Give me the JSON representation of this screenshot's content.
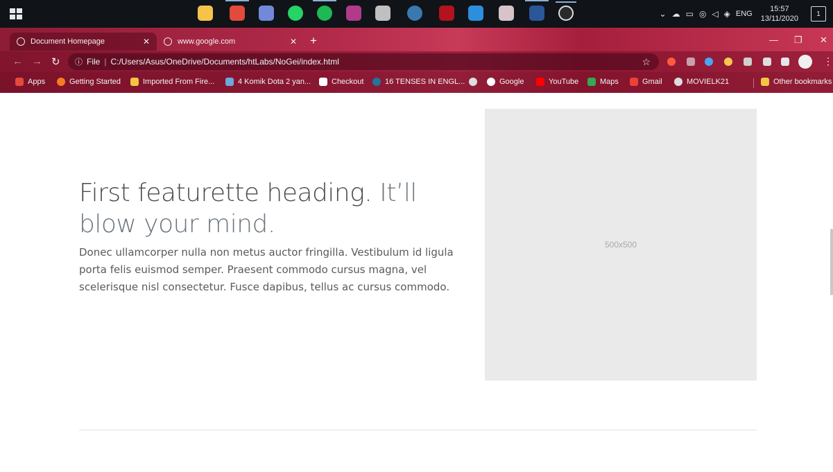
{
  "taskbar": {
    "apps": [
      {
        "icon": "file-explorer-icon",
        "color": "#f5c34a"
      },
      {
        "icon": "chrome-icon",
        "color": "#e24a3b"
      },
      {
        "icon": "discord-icon",
        "color": "#7289da"
      },
      {
        "icon": "whatsapp-icon",
        "color": "#25d366"
      },
      {
        "icon": "spotify-icon",
        "color": "#1db954"
      },
      {
        "icon": "winrar-icon",
        "color": "#b23a8a"
      },
      {
        "icon": "paint-icon",
        "color": "#bfbfbf"
      },
      {
        "icon": "steam-icon",
        "color": "#3a79b0"
      },
      {
        "icon": "dota-icon",
        "color": "#b3121e"
      },
      {
        "icon": "vscode-icon",
        "color": "#2c8fdb"
      },
      {
        "icon": "anime-app-icon",
        "color": "#d7c3c8"
      },
      {
        "icon": "word-icon",
        "color": "#2b579a"
      },
      {
        "icon": "obs-icon",
        "color": "#2a2a2a"
      }
    ],
    "tray": {
      "language": "ENG",
      "time": "15:57",
      "date": "13/11/2020",
      "notification_count": "1"
    }
  },
  "browser": {
    "tabs": [
      {
        "title": "Document Homepage",
        "active": true
      },
      {
        "title": "www.google.com",
        "active": false
      }
    ],
    "new_tab_label": "+",
    "address": {
      "scheme_label": "File",
      "url": "C:/Users/Asus/OneDrive/Documents/htLabs/NoGei/index.html"
    },
    "bookmarks": [
      {
        "label": "Apps",
        "icon": "apps-grid-icon",
        "color": "#e64a3b"
      },
      {
        "label": "Getting Started",
        "icon": "firefox-icon",
        "color": "#f57c20"
      },
      {
        "label": "Imported From Fire...",
        "icon": "folder-icon",
        "color": "#f4c542"
      },
      {
        "label": "4 Komik Dota 2 yan...",
        "icon": "page-icon",
        "color": "#6fa8dc"
      },
      {
        "label": "Checkout",
        "icon": "ggo-icon",
        "color": "#ffffff"
      },
      {
        "label": "16 TENSES IN ENGL...",
        "icon": "wordpress-icon",
        "color": "#21759b"
      },
      {
        "label": "",
        "icon": "globe-icon",
        "color": "#dddddd"
      },
      {
        "label": "Google",
        "icon": "google-icon",
        "color": "#ffffff"
      },
      {
        "label": "YouTube",
        "icon": "youtube-icon",
        "color": "#ff0000"
      },
      {
        "label": "Maps",
        "icon": "maps-icon",
        "color": "#34a853"
      },
      {
        "label": "Gmail",
        "icon": "gmail-icon",
        "color": "#ea4335"
      },
      {
        "label": "MOVIELK21",
        "icon": "globe-icon",
        "color": "#dddddd"
      }
    ],
    "other_bookmarks": "Other bookmarks"
  },
  "featurette": {
    "heading_main": "First featurette heading.",
    "heading_muted": "It’ll blow your mind.",
    "lead": "Donec ullamcorper nulla non metus auctor fringilla. Vestibulum id ligula porta felis euismod semper. Praesent commodo cursus magna, vel scelerisque nisl consectetur. Fusce dapibus, tellus ac cursus commodo.",
    "image_placeholder": "500x500"
  }
}
